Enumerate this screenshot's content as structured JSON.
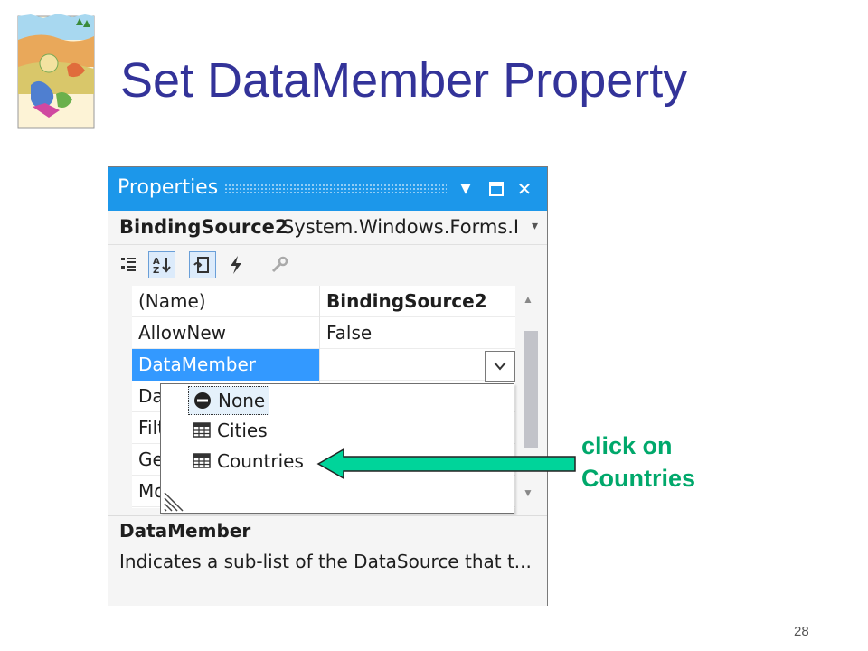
{
  "slide": {
    "title": "Set DataMember Property",
    "number": "28",
    "annotation_line1": "click on",
    "annotation_line2": "Countries"
  },
  "window": {
    "title": "Properties",
    "buttons": [
      "dropdown-arrow",
      "maximize",
      "close"
    ]
  },
  "object_selector": {
    "name": "BindingSource2",
    "type": "System.Windows.Forms.Bir"
  },
  "toolbar": {
    "icons": [
      "categorized-icon",
      "alphabetical-icon",
      "properties-icon",
      "events-icon",
      "property-pages-icon"
    ]
  },
  "grid": {
    "rows": [
      {
        "name": "(Name)",
        "value": "BindingSource2"
      },
      {
        "name": "AllowNew",
        "value": "False"
      },
      {
        "name": "DataMember",
        "value": ""
      },
      {
        "name": "Da",
        "value": ""
      },
      {
        "name": "Filt",
        "value": ""
      },
      {
        "name": "Ge",
        "value": ""
      },
      {
        "name": "Mo",
        "value": ""
      }
    ]
  },
  "dropdown": {
    "items": [
      {
        "label": "None",
        "icon": "none-icon"
      },
      {
        "label": "Cities",
        "icon": "table-icon"
      },
      {
        "label": "Countries",
        "icon": "table-icon"
      }
    ]
  },
  "description": {
    "title": "DataMember",
    "text": "Indicates a sub-list of the DataSource that t..."
  },
  "colors": {
    "title_bar": "#1c97ea",
    "selection": "#3399ff",
    "slide_title": "#333399",
    "annotation": "#00a86b"
  }
}
